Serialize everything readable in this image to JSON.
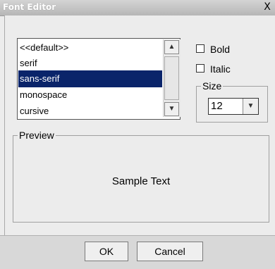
{
  "window": {
    "title": "Font Editor",
    "close_glyph": "X"
  },
  "font_list": {
    "items": [
      "<<default>>",
      "serif",
      "sans-serif",
      "monospace",
      "cursive"
    ],
    "selected": "sans-serif",
    "scroll_up_glyph": "▲",
    "scroll_down_glyph": "▼"
  },
  "style": {
    "bold_label": "Bold",
    "italic_label": "Italic",
    "bold_checked": false,
    "italic_checked": false
  },
  "size": {
    "group_label": "Size",
    "value": "12",
    "arrow_glyph": "▼"
  },
  "preview": {
    "group_label": "Preview",
    "sample_text": "Sample Text"
  },
  "buttons": {
    "ok_label": "OK",
    "cancel_label": "Cancel"
  },
  "colors": {
    "selection": "#0a246a",
    "titlebar": "#c4c4c4"
  }
}
